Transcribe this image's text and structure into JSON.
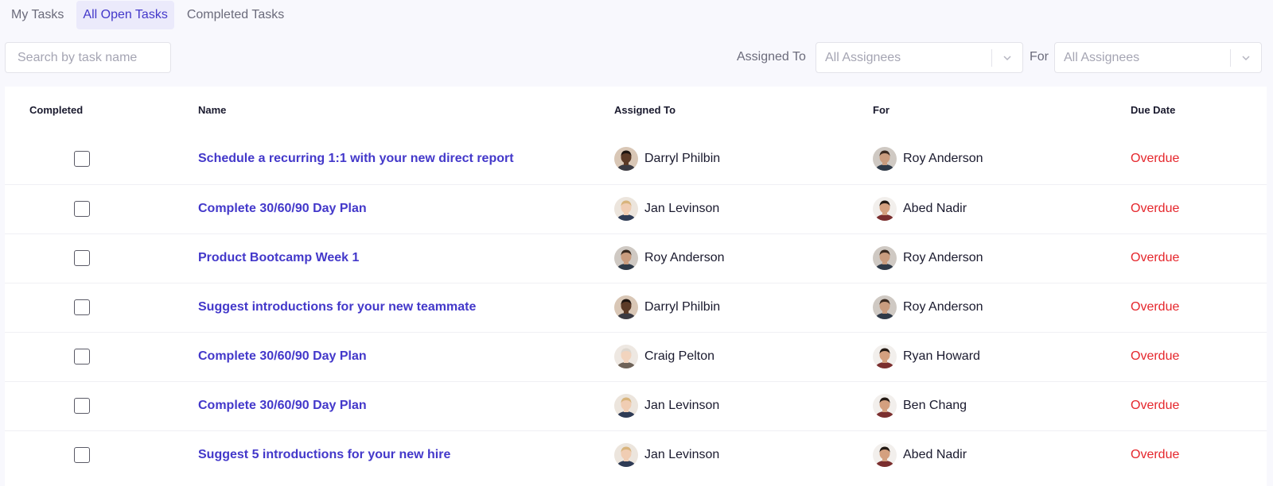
{
  "tabs": [
    {
      "label": "My Tasks"
    },
    {
      "label": "All Open Tasks"
    },
    {
      "label": "Completed Tasks"
    }
  ],
  "search": {
    "placeholder": "Search by task name"
  },
  "filters": {
    "assigned_to_label": "Assigned To",
    "assigned_to_value": "All Assignees",
    "for_label": "For",
    "for_value": "All Assignees"
  },
  "table": {
    "columns": [
      "Completed",
      "Name",
      "Assigned To",
      "For",
      "Due Date"
    ],
    "rows": [
      {
        "name": "Schedule a recurring 1:1 with your new direct report",
        "assigned_to": "Darryl Philbin",
        "for": "Roy Anderson",
        "due": "Overdue"
      },
      {
        "name": "Complete 30/60/90 Day Plan",
        "assigned_to": "Jan Levinson",
        "for": "Abed Nadir",
        "due": "Overdue"
      },
      {
        "name": "Product Bootcamp Week 1",
        "assigned_to": "Roy Anderson",
        "for": "Roy Anderson",
        "due": "Overdue"
      },
      {
        "name": "Suggest introductions for your new teammate",
        "assigned_to": "Darryl Philbin",
        "for": "Roy Anderson",
        "due": "Overdue"
      },
      {
        "name": "Complete 30/60/90 Day Plan",
        "assigned_to": "Craig Pelton",
        "for": "Ryan Howard",
        "due": "Overdue"
      },
      {
        "name": "Complete 30/60/90 Day Plan",
        "assigned_to": "Jan Levinson",
        "for": "Ben Chang",
        "due": "Overdue"
      },
      {
        "name": "Suggest 5 introductions for your new hire",
        "assigned_to": "Jan Levinson",
        "for": "Abed Nadir",
        "due": "Overdue"
      }
    ]
  },
  "colors": {
    "accent": "#4338ca",
    "overdue": "#e5262c"
  },
  "icons": {
    "select_chevron": "chevron-down-icon"
  }
}
